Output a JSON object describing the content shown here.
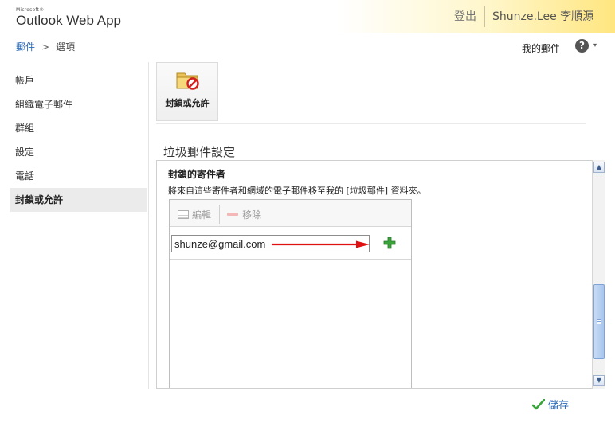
{
  "header": {
    "brand_small": "Microsoft®",
    "brand_name": "Outlook Web App",
    "sign_out": "登出",
    "user_name": "Shunze.Lee 李順源"
  },
  "breadcrumb": {
    "root": "郵件",
    "separator": ">",
    "current": "選項"
  },
  "topbar": {
    "my_mail": "我的郵件",
    "help_symbol": "?",
    "help_caret": "▾"
  },
  "sidebar": {
    "items": [
      {
        "label": "帳戶"
      },
      {
        "label": "組織電子郵件"
      },
      {
        "label": "群組"
      },
      {
        "label": "設定"
      },
      {
        "label": "電話"
      },
      {
        "label": "封鎖或允許"
      }
    ],
    "active_index": 5
  },
  "tile": {
    "label": "封鎖或允許",
    "icon": "folder-block-icon"
  },
  "section": {
    "title": "垃圾郵件設定"
  },
  "blocked": {
    "title": "封鎖的寄件者",
    "description": "將來自這些寄件者和網域的電子郵件移至我的 [垃圾郵件] 資料夾。",
    "edit_label": "編輯",
    "remove_label": "移除",
    "input_value": "shunze@gmail.com",
    "add_icon": "green-plus-icon"
  },
  "footer": {
    "save_label": "儲存",
    "save_icon": "green-check-icon"
  },
  "colors": {
    "accent_link": "#2a6ab8",
    "header_gradient_end": "#ffe680",
    "arrow": "#e01010",
    "add_green": "#3aa43a"
  }
}
